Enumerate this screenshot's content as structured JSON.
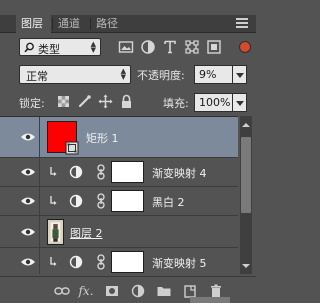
{
  "tabs": [
    {
      "label": "图层"
    },
    {
      "label": "通道"
    },
    {
      "label": "路径"
    }
  ],
  "filter": {
    "kind_label": "类型",
    "icons": [
      "image-filter-icon",
      "adjustment-filter-icon",
      "type-filter-icon",
      "shape-filter-icon",
      "smart-object-filter-icon"
    ]
  },
  "blend": {
    "mode": "正常",
    "opacity_label": "不透明度:",
    "opacity_value": "9%"
  },
  "lock": {
    "label": "锁定:",
    "fill_label": "填充:",
    "fill_value": "100%"
  },
  "layers": [
    {
      "name": "矩形 1",
      "type": "shape",
      "selected": true,
      "thumb_color": "#ff0000"
    },
    {
      "name": "渐变映射 4",
      "type": "adjustment"
    },
    {
      "name": "黑白 2",
      "type": "adjustment"
    },
    {
      "name": "图层 2",
      "type": "pixel"
    },
    {
      "name": "渐变映射 5",
      "type": "adjustment"
    }
  ],
  "colors": {
    "panel_bg": "#535353",
    "selected_row": "#7d8a9c",
    "shape_thumb": "#ff0000"
  }
}
